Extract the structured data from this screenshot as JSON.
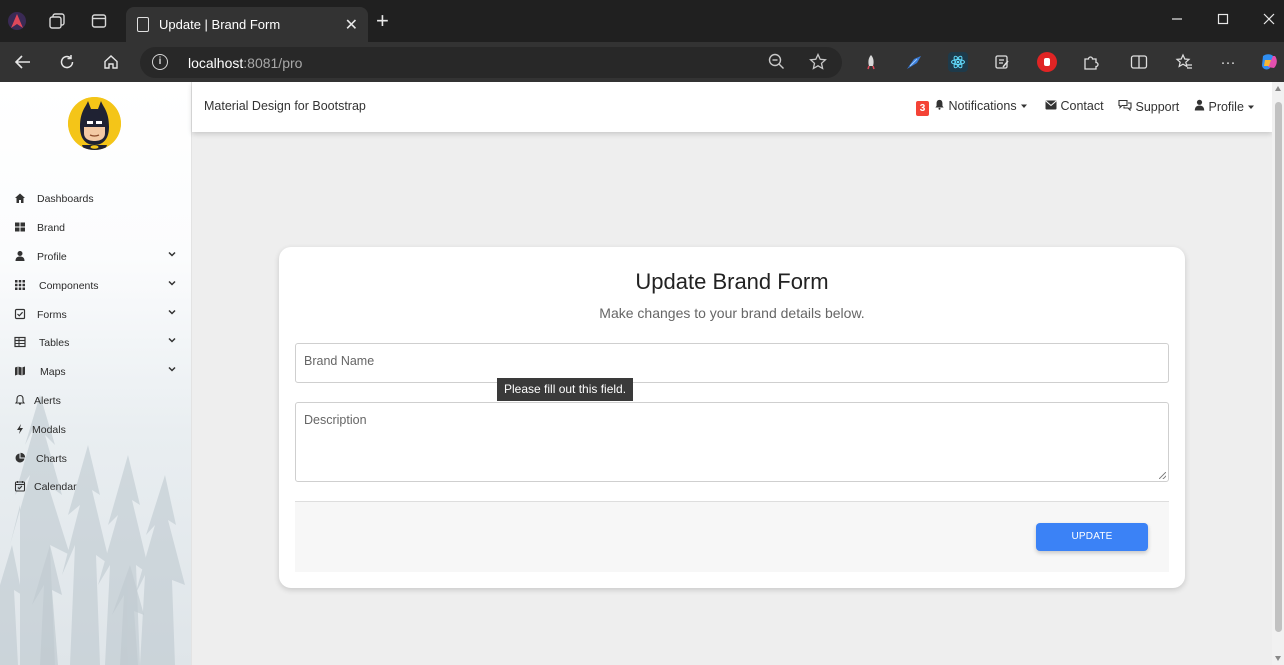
{
  "browser": {
    "tab_title": "Update | Brand Form",
    "url_host": "localhost",
    "url_rest": ":8081/pro",
    "close_glyph": "✕",
    "new_tab_glyph": "+",
    "info_glyph": "i",
    "menu_glyph": "···",
    "extensions": [
      "rocket-extension-icon",
      "feather-extension-icon",
      "react-devtools-icon",
      "notes-extension-icon",
      "adblock-extension-icon"
    ]
  },
  "sidebar": {
    "items": [
      {
        "label": "Dashboards",
        "icon": "home-icon"
      },
      {
        "label": "Brand",
        "icon": "grid-icon"
      },
      {
        "label": "Profile",
        "icon": "user-icon",
        "expandable": true
      },
      {
        "label": "Components",
        "icon": "apps-icon",
        "expandable": true
      },
      {
        "label": "Forms",
        "icon": "checkbox-icon",
        "expandable": true
      },
      {
        "label": "Tables",
        "icon": "table-icon",
        "expandable": true
      },
      {
        "label": "Maps",
        "icon": "map-icon",
        "expandable": true
      },
      {
        "label": "Alerts",
        "icon": "bell-icon"
      },
      {
        "label": "Modals",
        "icon": "bolt-icon"
      },
      {
        "label": "Charts",
        "icon": "pie-chart-icon"
      },
      {
        "label": "Calendar",
        "icon": "calendar-icon"
      }
    ]
  },
  "topnav": {
    "brand": "Material Design for Bootstrap",
    "notification_count": "3",
    "notifications": "Notifications",
    "contact": "Contact",
    "support": "Support",
    "profile": "Profile"
  },
  "form": {
    "title": "Update Brand Form",
    "subtitle": "Make changes to your brand details below.",
    "brand_name_placeholder": "Brand Name",
    "description_placeholder": "Description",
    "submit_label": "UPDATE",
    "validation_tooltip": "Please fill out this field."
  },
  "colors": {
    "accent": "#3b82f6",
    "badge": "#f44336",
    "avatar": "#f4c518"
  }
}
